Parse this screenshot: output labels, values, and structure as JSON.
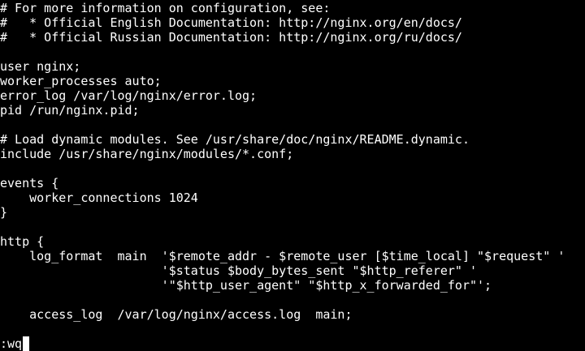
{
  "editor": {
    "lines": [
      "# For more information on configuration, see:",
      "#   * Official English Documentation: http://nginx.org/en/docs/",
      "#   * Official Russian Documentation: http://nginx.org/ru/docs/",
      "",
      "user nginx;",
      "worker_processes auto;",
      "error_log /var/log/nginx/error.log;",
      "pid /run/nginx.pid;",
      "",
      "# Load dynamic modules. See /usr/share/doc/nginx/README.dynamic.",
      "include /usr/share/nginx/modules/*.conf;",
      "",
      "events {",
      "    worker_connections 1024",
      "}",
      "",
      "http {",
      "    log_format  main  '$remote_addr - $remote_user [$time_local] \"$request\" '",
      "                      '$status $body_bytes_sent \"$http_referer\" '",
      "                      '\"$http_user_agent\" \"$http_x_forwarded_for\"';",
      "",
      "    access_log  /var/log/nginx/access.log  main;",
      ""
    ],
    "command": ":wq"
  },
  "colors": {
    "background": "#000000",
    "foreground": "#ffffff",
    "cursor": "#ffffff"
  }
}
